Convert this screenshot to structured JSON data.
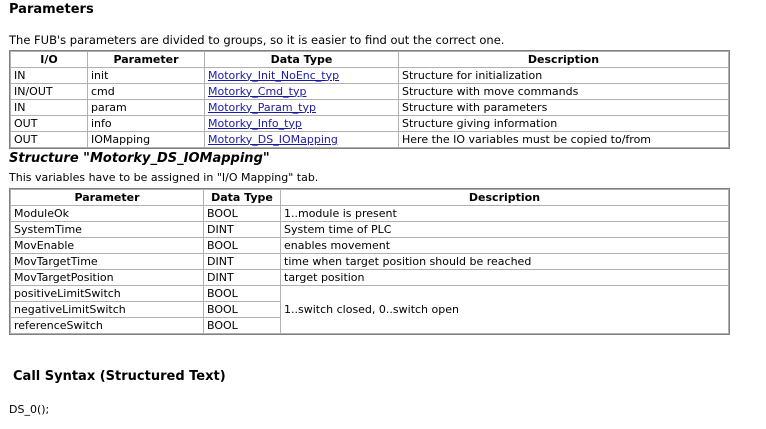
{
  "parameters": {
    "heading": "Parameters",
    "intro": "The FUB's parameters are divided to groups, so it is easier to find out the correct one.",
    "columns": [
      "I/O",
      "Parameter",
      "Data Type",
      "Description"
    ],
    "rows": [
      {
        "io": "IN",
        "param": "init",
        "type": "Motorky_Init_NoEnc_typ",
        "desc": "Structure for initialization"
      },
      {
        "io": "IN/OUT",
        "param": "cmd",
        "type": "Motorky_Cmd_typ",
        "desc": "Structure with move commands"
      },
      {
        "io": "IN",
        "param": "param",
        "type": "Motorky_Param_typ",
        "desc": "Structure with parameters"
      },
      {
        "io": "OUT",
        "param": "info",
        "type": "Motorky_Info_typ",
        "desc": "Structure giving information"
      },
      {
        "io": "OUT",
        "param": "IOMapping",
        "type": "Motorky_DS_IOMapping",
        "desc": "Here the IO variables must be copied to/from"
      }
    ]
  },
  "structure": {
    "title": "Structure \"Motorky_DS_IOMapping\"",
    "intro": "This variables have to be assigned in \"I/O Mapping\" tab.",
    "columns": [
      "Parameter",
      "Data Type",
      "Description"
    ],
    "rows": [
      {
        "param": "ModuleOk",
        "type": "BOOL",
        "desc": "1..module is present"
      },
      {
        "param": "SystemTime",
        "type": "DINT",
        "desc": "System time of PLC"
      },
      {
        "param": "MovEnable",
        "type": "BOOL",
        "desc": "enables movement"
      },
      {
        "param": "MovTargetTime",
        "type": "DINT",
        "desc": "time when target position should be reached"
      },
      {
        "param": "MovTargetPosition",
        "type": "DINT",
        "desc": "target position"
      },
      {
        "param": "positiveLimitSwitch",
        "type": "BOOL"
      },
      {
        "param": "negativeLimitSwitch",
        "type": "BOOL"
      },
      {
        "param": "referenceSwitch",
        "type": "BOOL"
      }
    ],
    "merged_desc": "1..switch closed, 0..switch open"
  },
  "call_syntax": {
    "heading": "Call Syntax (Structured Text)",
    "code": "DS_0();"
  }
}
